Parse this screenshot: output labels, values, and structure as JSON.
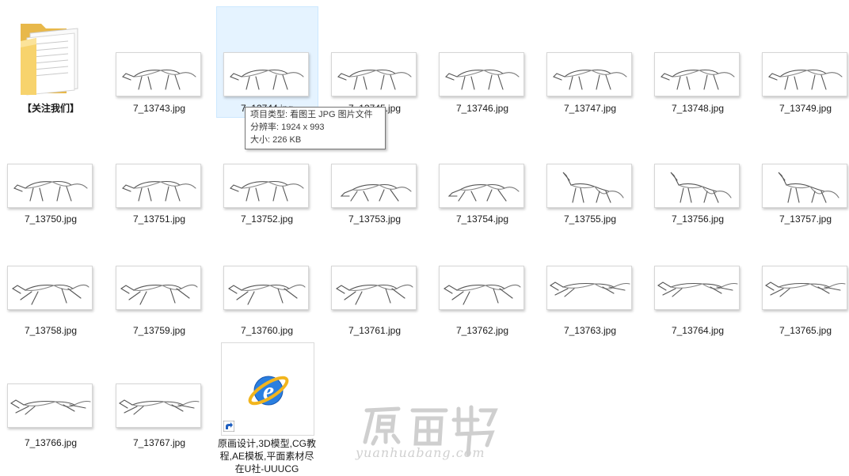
{
  "folder": {
    "label": "【关注我们】",
    "icon": "folder-icon"
  },
  "files": [
    {
      "name": "7_13743.jpg",
      "pose": "walk"
    },
    {
      "name": "7_13744.jpg",
      "pose": "walk"
    },
    {
      "name": "7_13745.jpg",
      "pose": "walk"
    },
    {
      "name": "7_13746.jpg",
      "pose": "walk"
    },
    {
      "name": "7_13747.jpg",
      "pose": "walk"
    },
    {
      "name": "7_13748.jpg",
      "pose": "walk"
    },
    {
      "name": "7_13749.jpg",
      "pose": "walk"
    },
    {
      "name": "7_13750.jpg",
      "pose": "walk"
    },
    {
      "name": "7_13751.jpg",
      "pose": "walk"
    },
    {
      "name": "7_13752.jpg",
      "pose": "walk"
    },
    {
      "name": "7_13753.jpg",
      "pose": "crouch"
    },
    {
      "name": "7_13754.jpg",
      "pose": "crouch"
    },
    {
      "name": "7_13755.jpg",
      "pose": "howl"
    },
    {
      "name": "7_13756.jpg",
      "pose": "howl"
    },
    {
      "name": "7_13757.jpg",
      "pose": "howl"
    },
    {
      "name": "7_13758.jpg",
      "pose": "run"
    },
    {
      "name": "7_13759.jpg",
      "pose": "run"
    },
    {
      "name": "7_13760.jpg",
      "pose": "run"
    },
    {
      "name": "7_13761.jpg",
      "pose": "run"
    },
    {
      "name": "7_13762.jpg",
      "pose": "run"
    },
    {
      "name": "7_13763.jpg",
      "pose": "leap"
    },
    {
      "name": "7_13764.jpg",
      "pose": "leap"
    },
    {
      "name": "7_13765.jpg",
      "pose": "leap"
    },
    {
      "name": "7_13766.jpg",
      "pose": "leap"
    },
    {
      "name": "7_13767.jpg",
      "pose": "leap"
    }
  ],
  "selected_file": "7_13744.jpg",
  "tooltip": {
    "line1": "项目类型: 看图王 JPG 图片文件",
    "line2": "分辨率: 1924 x 993",
    "line3": "大小: 226 KB"
  },
  "shortcut": {
    "label": "原画设计,3D模型,CG教程,AE模板,平面素材尽在U社-UUUCG",
    "icon": "internet-explorer-icon",
    "overlay": "shortcut-arrow-icon"
  },
  "watermark": {
    "text": "yuanhuabang.com"
  },
  "colors": {
    "selection": "#e5f3ff",
    "folder": "#f6d16a",
    "ie_blue": "#1a6fd6",
    "ie_ring": "#f2b51d"
  }
}
